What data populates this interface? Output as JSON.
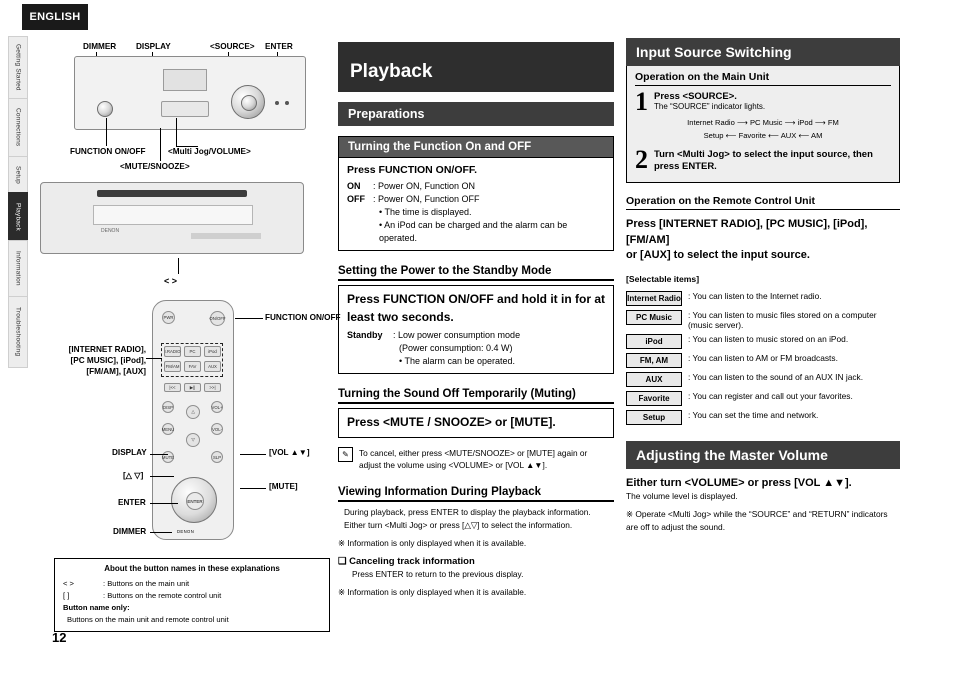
{
  "page": {
    "number": "12",
    "language_tab": "ENGLISH"
  },
  "sidebar": {
    "items": [
      {
        "label": "Getting Started",
        "active": false
      },
      {
        "label": "Connections",
        "active": false
      },
      {
        "label": "Setup",
        "active": false
      },
      {
        "label": "Playback",
        "active": true
      },
      {
        "label": "Information",
        "active": false
      },
      {
        "label": "Troubleshooting",
        "active": false
      }
    ]
  },
  "illustrations": {
    "main_unit_top_labels": [
      "DIMMER",
      "DISPLAY",
      "<SOURCE>",
      "ENTER"
    ],
    "main_unit_bottom_labels": [
      "FUNCTION ON/OFF",
      "<Multi Jog/VOLUME>",
      "<MUTE/SNOOZE>"
    ],
    "remote_labels_right": [
      "FUNCTION ON/OFF",
      "[VOL ▲▼]",
      "[MUTE]"
    ],
    "remote_labels_left": [
      "[INTERNET RADIO],",
      "[PC MUSIC], [iPod],",
      "[FM/AM], [AUX]",
      "DISPLAY",
      "[△ ▽]",
      "ENTER",
      "DIMMER"
    ],
    "unit_brand": "DENON",
    "remote_caption": "< >"
  },
  "legend": {
    "title": "About the button names in these explanations",
    "rows": [
      {
        "sym": "<    >",
        "desc": ": Buttons on the main unit"
      },
      {
        "sym": "[    ]",
        "desc": ": Buttons on the remote control unit"
      }
    ],
    "footer_label": "Button name only:",
    "footer_text": "Buttons on the main unit and remote control unit"
  },
  "middle": {
    "title": "Playback",
    "preparations_heading": "Preparations",
    "section1": {
      "heading": "Turning the Function On and OFF",
      "lead": "Press FUNCTION ON/OFF.",
      "rows": [
        {
          "k": "ON",
          "v": ": Power ON, Function ON"
        },
        {
          "k": "OFF",
          "v": ": Power ON, Function OFF"
        }
      ],
      "bullets": [
        "• The time is displayed.",
        "• An iPod can be charged and the alarm can be operated."
      ]
    },
    "section2": {
      "heading": "Setting the Power to the Standby Mode",
      "lead": "Press FUNCTION ON/OFF and hold it in for at least two seconds.",
      "standby_k": "Standby",
      "standby_v": ": Low power consumption mode",
      "bullets": [
        "(Power consumption: 0.4 W)",
        "• The alarm can be operated."
      ]
    },
    "section3": {
      "heading": "Turning the Sound Off Temporarily (Muting)",
      "lead": "Press <MUTE / SNOOZE> or [MUTE].",
      "note_icon": "pencil-icon",
      "note": "To cancel, either press <MUTE/SNOOZE> or [MUTE] again or adjust the volume using <VOLUME> or [VOL ▲▼]."
    },
    "section4": {
      "heading": "Viewing Information During Playback",
      "lines": [
        "During playback, press ENTER to display the playback information.",
        "Either turn <Multi Jog> or press [△▽] to select the information."
      ],
      "note1": "※ Information is only displayed when it is available.",
      "sub_heading": "❑ Canceling track information",
      "sub_text": "Press ENTER to return to the previous display.",
      "note2": "※ Information is only displayed when it is available."
    }
  },
  "right": {
    "input_heading": "Input Source Switching",
    "main_unit_heading": "Operation on the Main Unit",
    "step1": {
      "num": "1",
      "title": "Press <SOURCE>.",
      "desc": "The “SOURCE” indicator lights."
    },
    "flow": {
      "row1": [
        "Internet Radio",
        "PC Music",
        "iPod",
        "FM"
      ],
      "row2": [
        "Setup",
        "Favorite",
        "AUX",
        "AM"
      ]
    },
    "step2": {
      "num": "2",
      "title": "Turn <Multi Jog> to select the input source, then press ENTER."
    },
    "remote_heading": "Operation on the Remote Control Unit",
    "remote_text_line1": "Press [INTERNET RADIO], [PC MUSIC], [iPod], [FM/AM]",
    "remote_text_line2": "or [AUX] to select the input source.",
    "selectable_label": "[Selectable items]",
    "selectable": [
      {
        "key": "Internet Radio",
        "desc": ": You can listen to the Internet radio."
      },
      {
        "key": "PC Music",
        "desc": ": You can listen to music files stored on a computer (music server)."
      },
      {
        "key": "iPod",
        "desc": ": You can listen to music stored on an iPod."
      },
      {
        "key": "FM, AM",
        "desc": ": You can listen to AM or FM broadcasts."
      },
      {
        "key": "AUX",
        "desc": ": You can listen to the sound of an AUX IN jack."
      },
      {
        "key": "Favorite",
        "desc": ": You can register and call out your favorites."
      },
      {
        "key": "Setup",
        "desc": ": You can set the time and network."
      }
    ],
    "volume_heading": "Adjusting the Master Volume",
    "volume_lead": "Either turn <VOLUME> or press [VOL ▲▼].",
    "volume_sub": "The volume level is displayed.",
    "volume_note": "※ Operate <Multi Jog> while the “SOURCE” and “RETURN” indicators are off to adjust the sound."
  }
}
